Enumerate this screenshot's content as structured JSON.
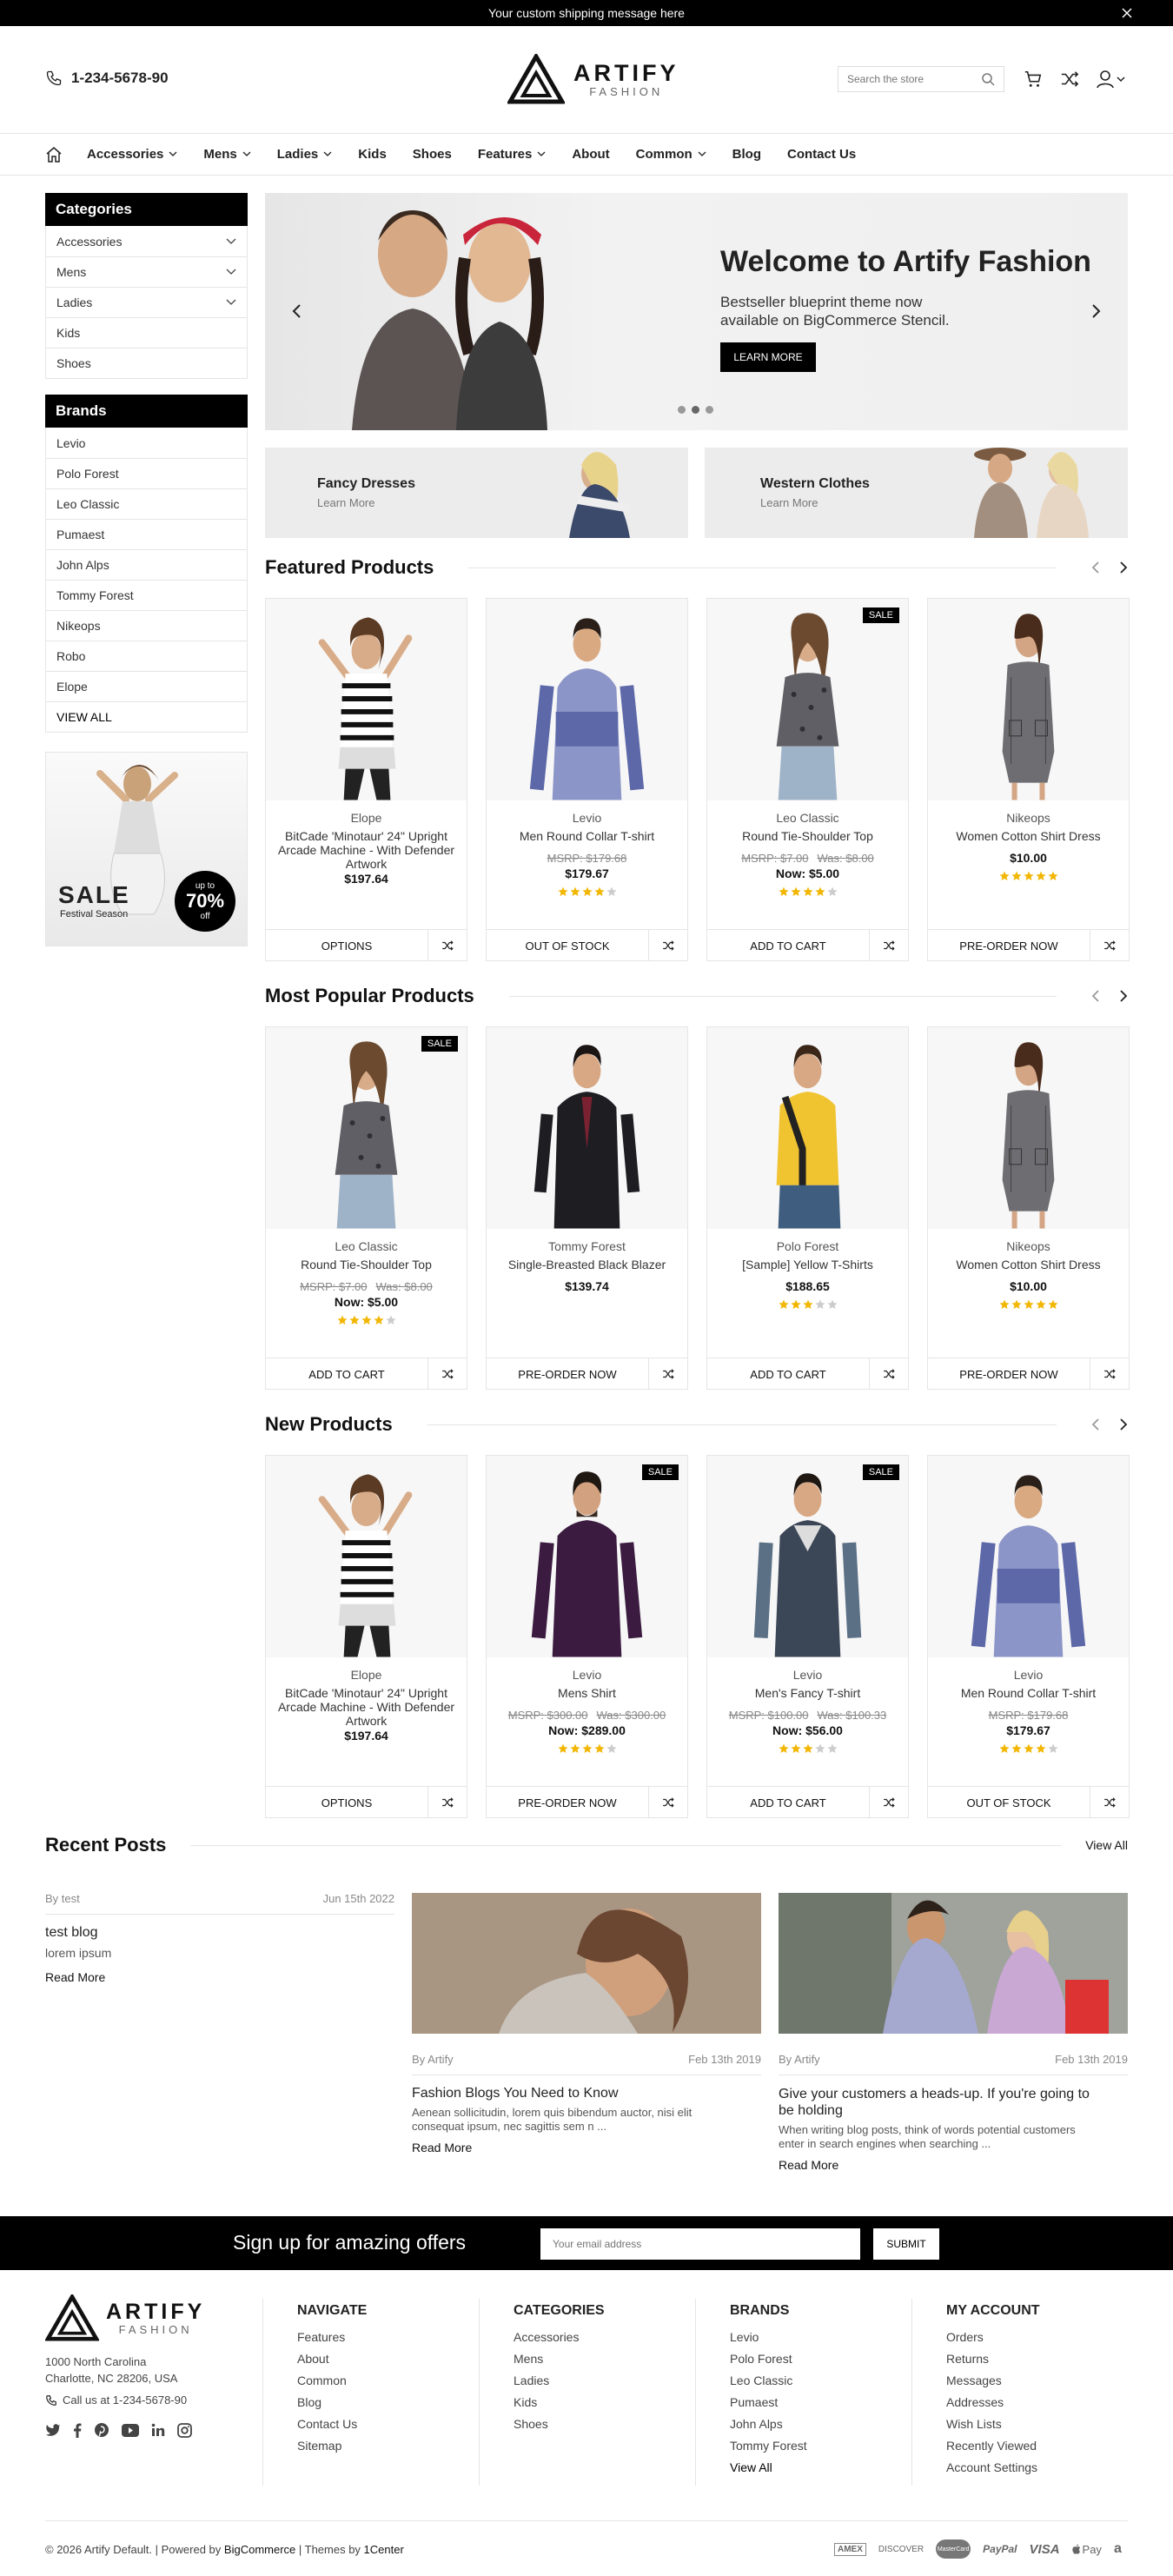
{
  "topbar": {
    "message": "Your custom shipping message here"
  },
  "header": {
    "phone": "1-234-5678-90",
    "logo_name": "ARTIFY",
    "logo_sub": "FASHION",
    "search_placeholder": "Search the store"
  },
  "nav": [
    {
      "label": "Accessories",
      "dropdown": true
    },
    {
      "label": "Mens",
      "dropdown": true
    },
    {
      "label": "Ladies",
      "dropdown": true
    },
    {
      "label": "Kids",
      "dropdown": false
    },
    {
      "label": "Shoes",
      "dropdown": false
    },
    {
      "label": "Features",
      "dropdown": true
    },
    {
      "label": "About",
      "dropdown": false
    },
    {
      "label": "Common",
      "dropdown": true
    },
    {
      "label": "Blog",
      "dropdown": false
    },
    {
      "label": "Contact Us",
      "dropdown": false
    }
  ],
  "categories": {
    "title": "Categories",
    "items": [
      {
        "label": "Accessories",
        "expand": true
      },
      {
        "label": "Mens",
        "expand": true
      },
      {
        "label": "Ladies",
        "expand": true
      },
      {
        "label": "Kids",
        "expand": false
      },
      {
        "label": "Shoes",
        "expand": false
      }
    ]
  },
  "brands": {
    "title": "Brands",
    "items": [
      "Levio",
      "Polo Forest",
      "Leo Classic",
      "Pumaest",
      "John Alps",
      "Tommy Forest",
      "Nikeops",
      "Robo",
      "Elope",
      "VIEW ALL"
    ]
  },
  "sidebanner": {
    "sale": "SALE",
    "season": "Festival Season",
    "upto": "up to",
    "pct": "70%",
    "off": "off"
  },
  "hero": {
    "title": "Welcome to Artify Fashion",
    "line1": "Bestseller blueprint theme now",
    "line2": "available on BigCommerce Stencil.",
    "button": "LEARN MORE"
  },
  "promos": [
    {
      "title": "Fancy Dresses",
      "link": "Learn More"
    },
    {
      "title": "Western Clothes",
      "link": "Learn More"
    }
  ],
  "sections": [
    {
      "title": "Featured Products",
      "products": [
        {
          "brand": "Elope",
          "name": "BitCade 'Minotaur' 24\" Upright Arcade Machine - With Defender Artwork",
          "msrp": "",
          "was": "",
          "price": "$197.64",
          "rating": 0,
          "sale": false,
          "button": "OPTIONS",
          "fig": "stripe"
        },
        {
          "brand": "Levio",
          "name": "Men Round Collar T-shirt",
          "msrp": "MSRP: $179.68",
          "was": "",
          "price": "$179.67",
          "rating": 4,
          "sale": false,
          "button": "OUT OF STOCK",
          "fig": "blue"
        },
        {
          "brand": "Leo Classic",
          "name": "Round Tie-Shoulder Top",
          "msrp": "MSRP: $7.00",
          "was": "Was: $8.00",
          "price": "Now: $5.00",
          "rating": 4,
          "sale": true,
          "button": "ADD TO CART",
          "fig": "grey"
        },
        {
          "brand": "Nikeops",
          "name": "Women Cotton Shirt Dress",
          "msrp": "",
          "was": "",
          "price": "$10.00",
          "rating": 5,
          "sale": false,
          "button": "PRE-ORDER NOW",
          "fig": "dress"
        }
      ]
    },
    {
      "title": "Most Popular Products",
      "products": [
        {
          "brand": "Leo Classic",
          "name": "Round Tie-Shoulder Top",
          "msrp": "MSRP: $7.00",
          "was": "Was: $8.00",
          "price": "Now: $5.00",
          "rating": 4,
          "sale": true,
          "button": "ADD TO CART",
          "fig": "grey"
        },
        {
          "brand": "Tommy Forest",
          "name": "Single-Breasted Black Blazer",
          "msrp": "",
          "was": "",
          "price": "$139.74",
          "rating": 0,
          "sale": false,
          "button": "PRE-ORDER NOW",
          "fig": "blazer"
        },
        {
          "brand": "Polo Forest",
          "name": "[Sample] Yellow T-Shirts",
          "msrp": "",
          "was": "",
          "price": "$188.65",
          "rating": 3,
          "sale": false,
          "button": "ADD TO CART",
          "fig": "yellow"
        },
        {
          "brand": "Nikeops",
          "name": "Women Cotton Shirt Dress",
          "msrp": "",
          "was": "",
          "price": "$10.00",
          "rating": 5,
          "sale": false,
          "button": "PRE-ORDER NOW",
          "fig": "dress"
        }
      ]
    },
    {
      "title": "New Products",
      "products": [
        {
          "brand": "Elope",
          "name": "BitCade 'Minotaur' 24\" Upright Arcade Machine - With Defender Artwork",
          "msrp": "",
          "was": "",
          "price": "$197.64",
          "rating": 0,
          "sale": false,
          "button": "OPTIONS",
          "fig": "stripe"
        },
        {
          "brand": "Levio",
          "name": "Mens Shirt",
          "msrp": "MSRP: $300.00",
          "was": "Was: $300.00",
          "price": "Now: $289.00",
          "rating": 4,
          "sale": true,
          "button": "PRE-ORDER NOW",
          "fig": "purple"
        },
        {
          "brand": "Levio",
          "name": "Men's Fancy T-shirt",
          "msrp": "MSRP: $100.00",
          "was": "Was: $100.33",
          "price": "Now: $56.00",
          "rating": 3,
          "sale": true,
          "button": "ADD TO CART",
          "fig": "navy"
        },
        {
          "brand": "Levio",
          "name": "Men Round Collar T-shirt",
          "msrp": "MSRP: $179.68",
          "was": "",
          "price": "$179.67",
          "rating": 4,
          "sale": false,
          "button": "OUT OF STOCK",
          "fig": "blue"
        }
      ]
    }
  ],
  "recent": {
    "title": "Recent Posts",
    "view_all": "View All",
    "side": {
      "author": "By test",
      "date": "Jun 15th 2022",
      "title": "test blog",
      "excerpt": "lorem ipsum",
      "link": "Read More"
    },
    "posts": [
      {
        "author": "By Artify",
        "date": "Feb 13th 2019",
        "title": "Fashion Blogs You Need to Know",
        "excerpt1": "Aenean sollicitudin, lorem quis bibendum auctor, nisi elit",
        "excerpt2": "consequat ipsum, nec sagittis sem n ...",
        "link": "Read More"
      },
      {
        "author": "By Artify",
        "date": "Feb 13th 2019",
        "title1": "Give your customers a heads-up. If you're going to",
        "title2": "be holding",
        "excerpt1": "When writing blog posts, think of words potential customers",
        "excerpt2": "enter in search engines when searching ...",
        "link": "Read More"
      }
    ]
  },
  "newsletter": {
    "title": "Sign up for amazing offers",
    "placeholder": "Your email address",
    "button": "SUBMIT"
  },
  "footer": {
    "address1": "1000 North Carolina",
    "address2": "Charlotte, NC 28206, USA",
    "call": "Call us at 1-234-5678-90",
    "cols": [
      {
        "title": "NAVIGATE",
        "links": [
          "Features",
          "About",
          "Common",
          "Blog",
          "Contact Us",
          "Sitemap"
        ]
      },
      {
        "title": "CATEGORIES",
        "links": [
          "Accessories",
          "Mens",
          "Ladies",
          "Kids",
          "Shoes"
        ]
      },
      {
        "title": "BRANDS",
        "links": [
          "Levio",
          "Polo Forest",
          "Leo Classic",
          "Pumaest",
          "John Alps",
          "Tommy Forest",
          "View All"
        ]
      },
      {
        "title": "MY ACCOUNT",
        "links": [
          "Orders",
          "Returns",
          "Messages",
          "Addresses",
          "Wish Lists",
          "Recently Viewed",
          "Account Settings"
        ]
      }
    ],
    "copyright_a": "© 2026 Artify Default. | Powered by ",
    "copyright_b": "BigCommerce",
    "copyright_c": " | Themes by ",
    "copyright_d": "1Center",
    "payments": [
      "AMEX",
      "DISCOVER",
      "MasterCard",
      "PayPal",
      "VISA",
      "Pay",
      "a"
    ]
  },
  "colors": {
    "accent": "#000000",
    "star": "#f2b705",
    "star_off": "#cccccc"
  }
}
